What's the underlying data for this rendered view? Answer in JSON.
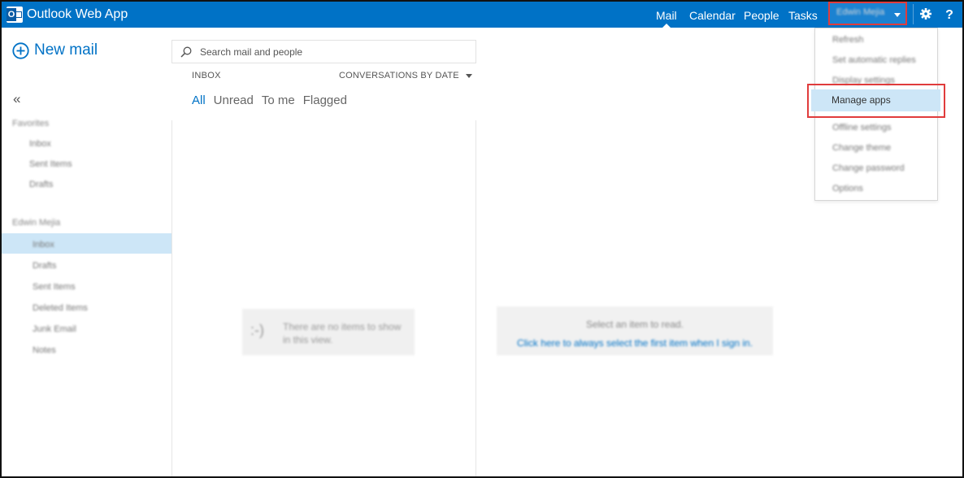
{
  "topbar": {
    "app_title": "Outlook Web App",
    "nav": [
      "Mail",
      "Calendar",
      "People",
      "Tasks"
    ],
    "active_nav": "Mail",
    "user_name": "Edwin Mejia",
    "help_label": "?"
  },
  "sidebar": {
    "new_mail_label": "New mail",
    "collapse_glyph": "«",
    "favorites_header": "Favorites",
    "favorites": [
      "Inbox",
      "Sent Items",
      "Drafts"
    ],
    "account_header": "Edwin Mejia",
    "folders": [
      "Inbox",
      "Drafts",
      "Sent Items",
      "Deleted Items",
      "Junk Email",
      "Notes"
    ],
    "selected_folder": "Inbox"
  },
  "list": {
    "search_placeholder": "Search mail and people",
    "folder_label": "INBOX",
    "sort_label": "CONVERSATIONS BY DATE",
    "filters": [
      "All",
      "Unread",
      "To me",
      "Flagged"
    ],
    "active_filter": "All",
    "empty_face": ":-)",
    "empty_message": "There are no items to show in this view."
  },
  "reading_pane": {
    "message": "Select an item to read.",
    "link": "Click here to always select the first item when I sign in."
  },
  "settings_menu": {
    "items": [
      "Refresh",
      "Set automatic replies",
      "Display settings",
      "Manage apps",
      "Offline settings",
      "Change theme",
      "Change password",
      "Options"
    ],
    "highlighted": "Manage apps"
  },
  "colors": {
    "accent": "#0072c6",
    "selection": "#cde6f7",
    "highlight_border": "#e03c3c"
  },
  "icons": {
    "brand": "outlook-logo-icon",
    "new_mail": "plus-circle-icon",
    "search": "search-icon",
    "settings": "gear-icon",
    "help": "help-icon",
    "collapse": "double-chevron-left-icon"
  }
}
